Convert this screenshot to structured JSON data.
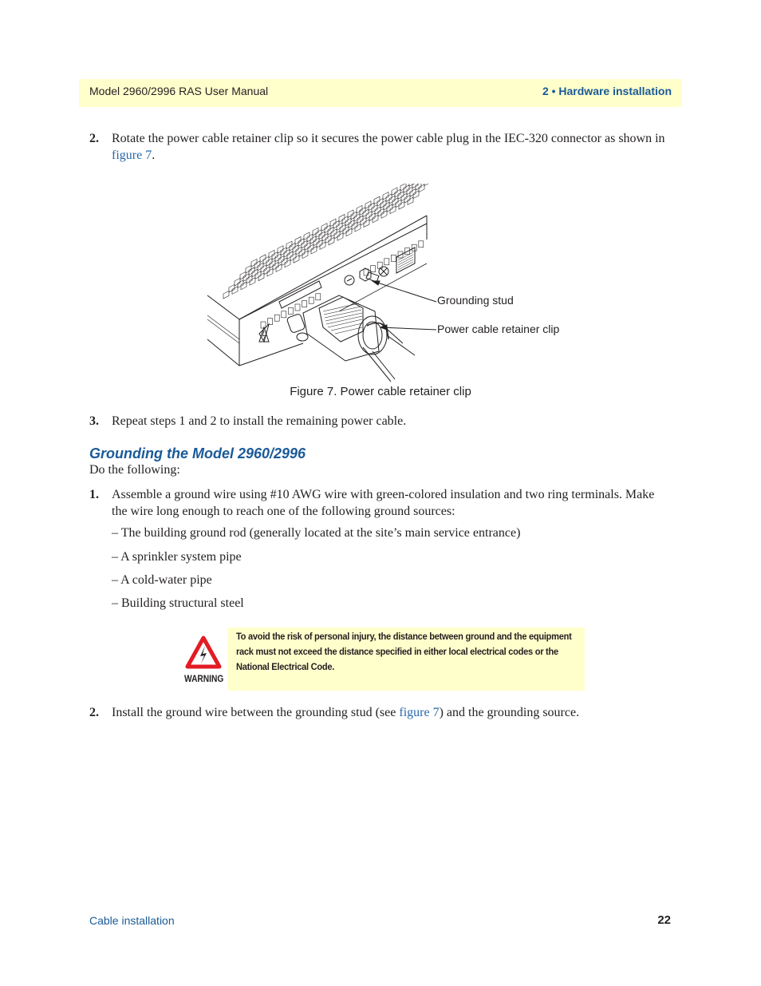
{
  "header": {
    "title": "Model 2960/2996 RAS User Manual",
    "section": "2 • Hardware installation"
  },
  "steps_top": [
    {
      "number": "2.",
      "text_before": "Rotate the power cable retainer clip so it secures the power cable plug in the IEC-320 connector as shown in ",
      "link": "figure 7",
      "text_after": "."
    },
    {
      "number": "3.",
      "text": "Repeat steps 1 and 2 to install the remaining power cable."
    }
  ],
  "figure": {
    "caption": "Figure 7. Power cable retainer clip",
    "callouts": [
      "Grounding stud",
      "Power cable retainer clip"
    ],
    "icons": [
      "device-chassis",
      "grounding-stud",
      "power-connector",
      "retainer-clip",
      "warning-triangle"
    ]
  },
  "grounding": {
    "heading": "Grounding the Model 2960/2996",
    "intro": "Do the following:",
    "step1": {
      "number": "1.",
      "text": "Assemble a ground wire using #10 AWG wire with green-colored insulation and two ring terminals. Make the wire long enough to reach one of the following ground sources:"
    },
    "sources": [
      "– The building ground rod (generally located at the site’s main service entrance)",
      "– A sprinkler system pipe",
      "– A cold-water pipe",
      "– Building structural steel"
    ],
    "warning": {
      "label": "WARNING",
      "icon": "warning-electrical-icon",
      "text": "To avoid the risk of personal injury, the distance between ground and the equipment rack must not exceed the distance specified in either local electrical codes or the National Electrical Code."
    },
    "step2": {
      "number": "2.",
      "text_before": "Install the ground wire between the grounding stud (see ",
      "link": "figure 7",
      "text_after": ") and the grounding source."
    }
  },
  "footer": {
    "section": "Cable installation",
    "page": "22"
  },
  "colors": {
    "accent_blue": "#1a5a98",
    "link_blue": "#2868a8",
    "header_bg": "#ffffcc",
    "warning_red": "#e31b23"
  }
}
